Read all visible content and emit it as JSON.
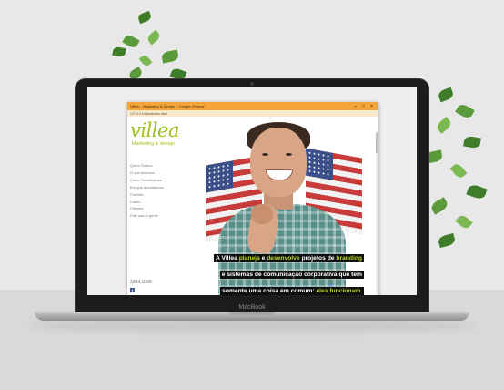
{
  "device": {
    "bezel_label": "MacBook"
  },
  "browser": {
    "title": "Villea – Marketing & Design – Google Chrome",
    "window_controls": {
      "minimize": "–",
      "maximize": "□",
      "close": "×"
    },
    "address": "127.0.0.1/villea/index.html",
    "titlebar_color": "#f5a43a"
  },
  "site": {
    "logo_main": "villea",
    "logo_sub": "Marketing & design",
    "brand_color": "#9cc11a",
    "menu": [
      "Quem Somos",
      "O que fazemos",
      "Como Trabalhamos",
      "Em que acreditamos",
      "Portfólio",
      "Cases",
      "Clientes",
      "Fale com a gente"
    ],
    "phone": "3384.1090",
    "facebook_icon": "f",
    "hero": {
      "l1_pre": "A Villea ",
      "l1_h1": "planeja",
      "l1_mid": " e ",
      "l1_h2": "desenvolve",
      "l1_mid2": " projetos de ",
      "l1_h3": "branding",
      "l2": "e sistemas de comunicação corporativa que tem",
      "l3_pre": "somente uma coisa em comum: ",
      "l3_h": "eles funcionam",
      "l3_post": "."
    }
  }
}
